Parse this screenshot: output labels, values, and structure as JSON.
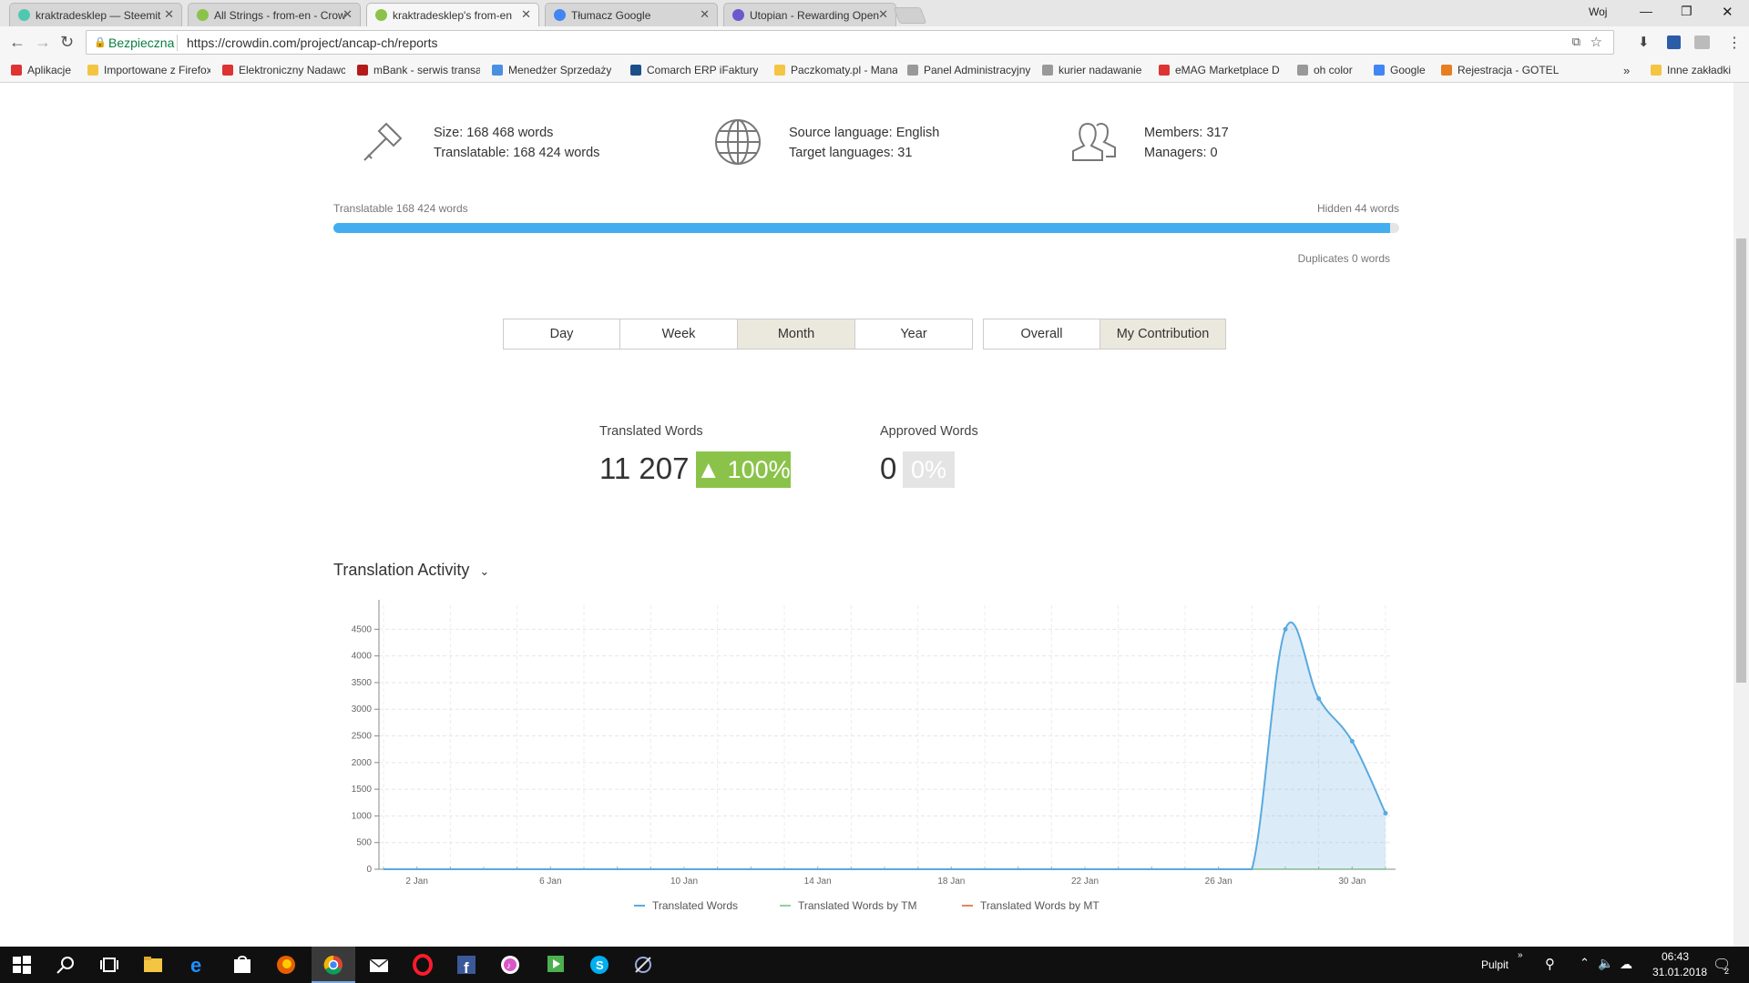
{
  "browser": {
    "tabs": [
      {
        "title": "kraktradesklep — Steemit",
        "favicon_color": "#4ec9b0",
        "active": false
      },
      {
        "title": "All Strings - from-en - Crowdin",
        "favicon_color": "#8bc34a",
        "active": false
      },
      {
        "title": "kraktradesklep's from-en",
        "favicon_color": "#8bc34a",
        "active": true
      },
      {
        "title": "Tłumacz Google",
        "favicon_color": "#4285f4",
        "active": false
      },
      {
        "title": "Utopian - Rewarding Open Source",
        "favicon_color": "#6a5acd",
        "active": false
      }
    ],
    "user_label": "Woj",
    "secure_label": "Bezpieczna",
    "url": "https://crowdin.com/project/ancap-ch/reports",
    "bookmarks": [
      {
        "label": "Aplikacje",
        "color": "#d33"
      },
      {
        "label": "Importowane z Firefox",
        "color": "#f4c542"
      },
      {
        "label": "Elektroniczny Nadawca",
        "color": "#d33"
      },
      {
        "label": "mBank - serwis transakcyjny",
        "color": "#b31b1b"
      },
      {
        "label": "Menedżer Sprzedaży",
        "color": "#4a90e2"
      },
      {
        "label": "Comarch ERP iFaktury",
        "color": "#1b4f8a"
      },
      {
        "label": "Paczkomaty.pl - Manager",
        "color": "#f4c542"
      },
      {
        "label": "Panel Administracyjny",
        "color": "#999"
      },
      {
        "label": "kurier nadawanie",
        "color": "#999"
      },
      {
        "label": "eMAG Marketplace D",
        "color": "#d33"
      },
      {
        "label": "oh color",
        "color": "#999"
      },
      {
        "label": "Google",
        "color": "#4285f4"
      },
      {
        "label": "Rejestracja - GOTEL",
        "color": "#e67e22"
      }
    ],
    "bookmarks_overflow": "»",
    "other_bookmarks": "Inne zakładki"
  },
  "stats": {
    "size": "Size: 168 468 words",
    "translatable": "Translatable: 168 424 words",
    "source_language": "Source language: English",
    "target_languages": "Target languages: 31",
    "members": "Members: 317",
    "managers": "Managers: 0"
  },
  "progress": {
    "left_label": "Translatable 168 424 words",
    "right_label": "Hidden 44 words",
    "duplicates_label": "Duplicates 0 words",
    "fraction": 0.9997
  },
  "period_buttons": [
    {
      "label": "Day",
      "selected": false
    },
    {
      "label": "Week",
      "selected": false
    },
    {
      "label": "Month",
      "selected": true
    },
    {
      "label": "Year",
      "selected": false
    }
  ],
  "scope_buttons": [
    {
      "label": "Overall",
      "selected": false
    },
    {
      "label": "My Contribution",
      "selected": true
    }
  ],
  "metrics": {
    "translated_label": "Translated Words",
    "translated_value": "11 207",
    "translated_change": "▲ 100%",
    "approved_label": "Approved Words",
    "approved_value": "0",
    "approved_change": "0%"
  },
  "activity_title": "Translation Activity",
  "chart_data": {
    "type": "area",
    "title": "Translation Activity",
    "x": [
      "1 Jan",
      "2 Jan",
      "3 Jan",
      "4 Jan",
      "5 Jan",
      "6 Jan",
      "7 Jan",
      "8 Jan",
      "9 Jan",
      "10 Jan",
      "11 Jan",
      "12 Jan",
      "13 Jan",
      "14 Jan",
      "15 Jan",
      "16 Jan",
      "17 Jan",
      "18 Jan",
      "19 Jan",
      "20 Jan",
      "21 Jan",
      "22 Jan",
      "23 Jan",
      "24 Jan",
      "25 Jan",
      "26 Jan",
      "27 Jan",
      "28 Jan",
      "29 Jan",
      "30 Jan",
      "31 Jan"
    ],
    "x_tick_labels": [
      "2 Jan",
      "6 Jan",
      "10 Jan",
      "14 Jan",
      "18 Jan",
      "22 Jan",
      "26 Jan",
      "30 Jan"
    ],
    "y_ticks": [
      0,
      500,
      1000,
      1500,
      2000,
      2500,
      3000,
      3500,
      4000,
      4500
    ],
    "ylim": [
      0,
      4950
    ],
    "series": [
      {
        "name": "Translated Words",
        "color": "#5aa9e0",
        "values": [
          0,
          0,
          0,
          0,
          0,
          0,
          0,
          0,
          0,
          0,
          0,
          0,
          0,
          0,
          0,
          0,
          0,
          0,
          0,
          0,
          0,
          0,
          0,
          0,
          0,
          0,
          0,
          4500,
          3200,
          2400,
          1050
        ]
      },
      {
        "name": "Translated Words by TM",
        "color": "#8fd19e",
        "values": [
          0,
          0,
          0,
          0,
          0,
          0,
          0,
          0,
          0,
          0,
          0,
          0,
          0,
          0,
          0,
          0,
          0,
          0,
          0,
          0,
          0,
          0,
          0,
          0,
          0,
          0,
          0,
          0,
          0,
          0,
          0
        ]
      },
      {
        "name": "Translated Words by MT",
        "color": "#e8845b",
        "values": [
          0,
          0,
          0,
          0,
          0,
          0,
          0,
          0,
          0,
          0,
          0,
          0,
          0,
          0,
          0,
          0,
          0,
          0,
          0,
          0,
          0,
          0,
          0,
          0,
          0,
          0,
          0,
          0,
          0,
          0,
          0
        ]
      }
    ],
    "grid": true,
    "legend": "bottom-center"
  },
  "taskbar": {
    "desktop_label": "Pulpit",
    "time": "06:43",
    "date": "31.01.2018",
    "notifications": "2"
  }
}
